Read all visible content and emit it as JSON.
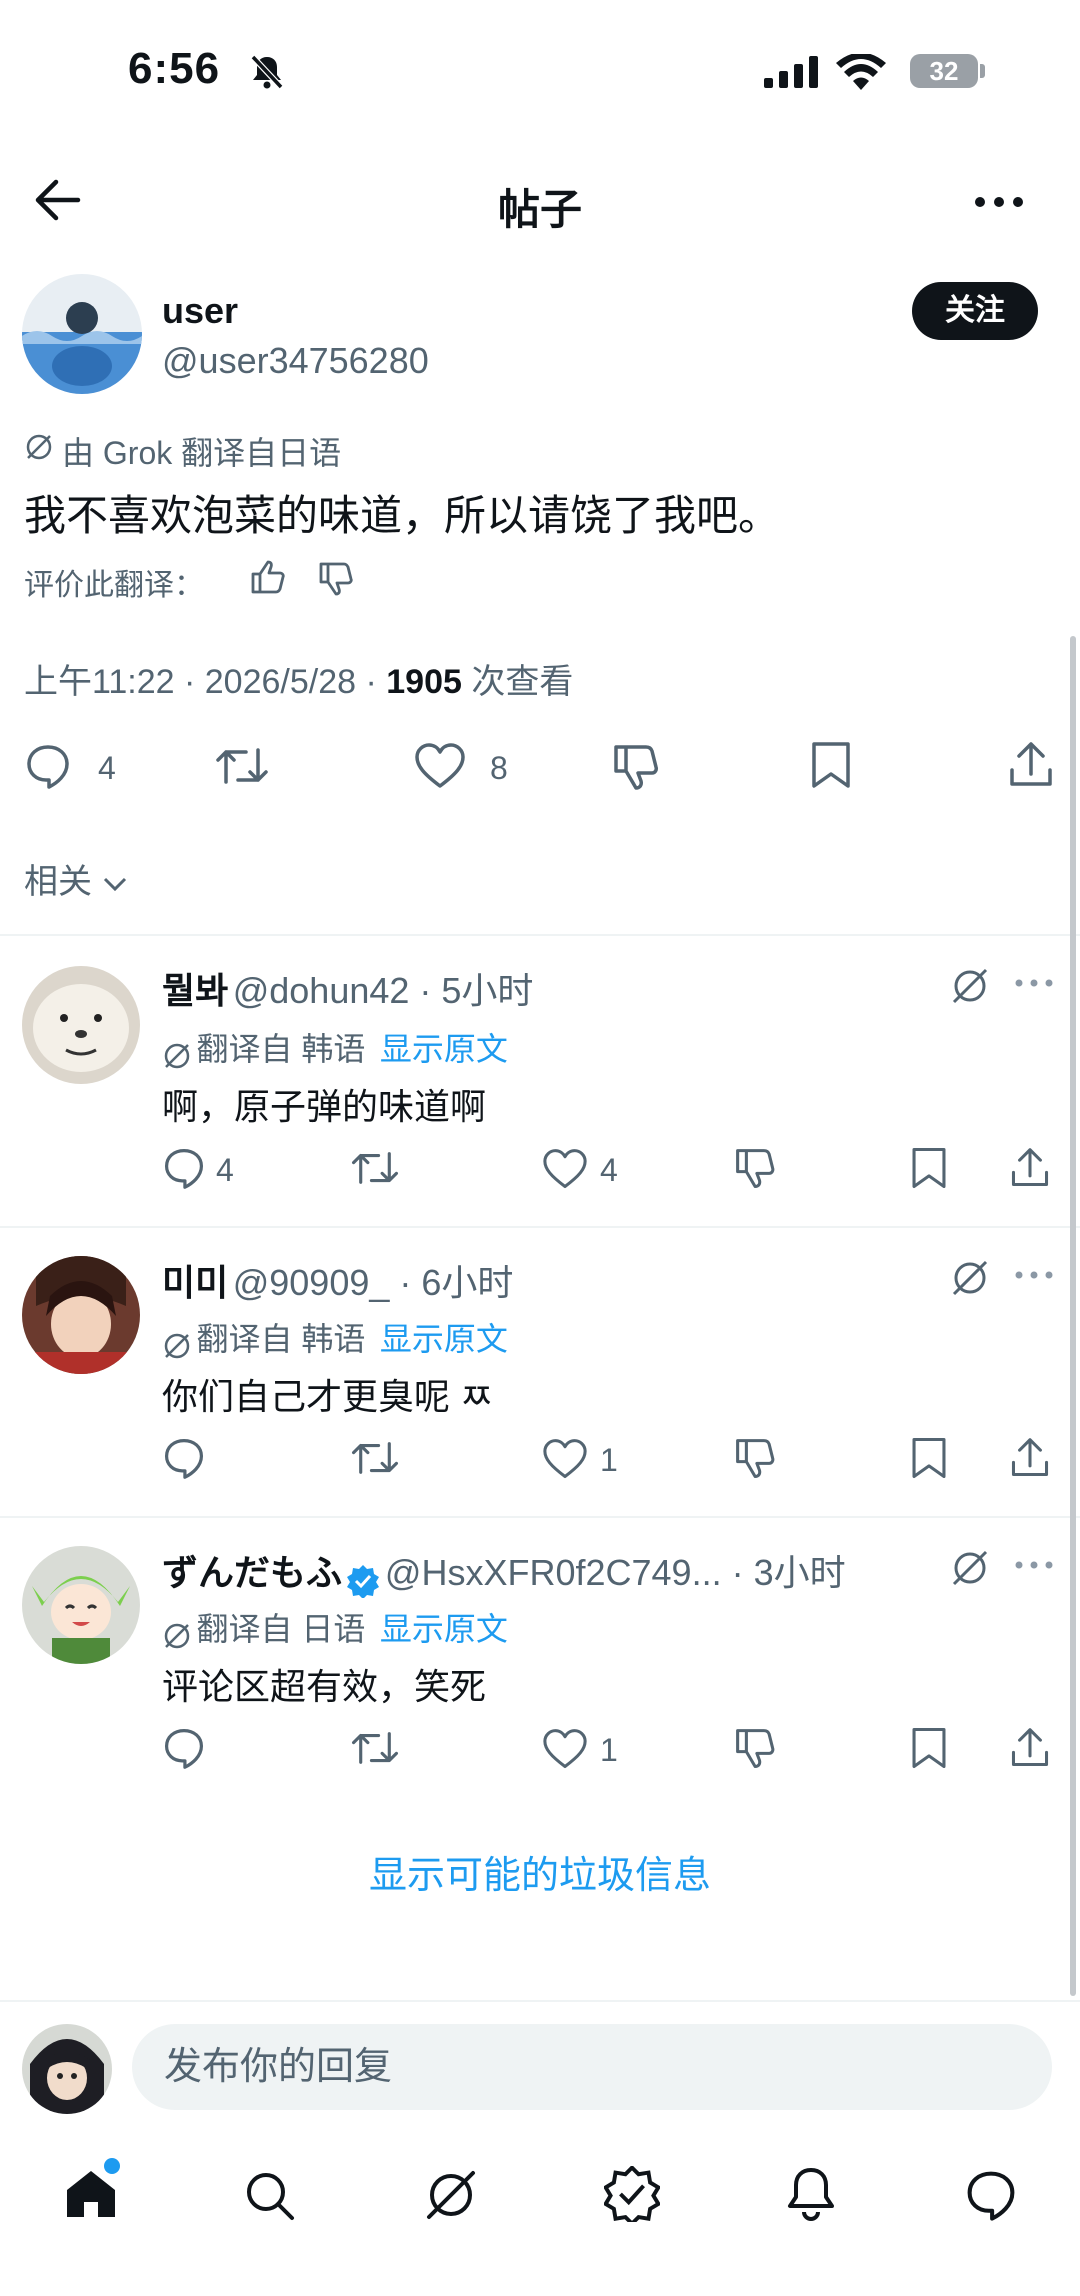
{
  "status_bar": {
    "time": "6:56",
    "battery": "32"
  },
  "header": {
    "title": "帖子"
  },
  "post": {
    "name": "user",
    "handle": "@user34756280",
    "follow_label": "关注",
    "translated_note": "由 Grok 翻译自日语",
    "text": "我不喜欢泡菜的味道，所以请饶了我吧。",
    "rate_translation": "评价此翻译：",
    "time": "上午11:22 · 2026/5/28 · ",
    "views": "1905",
    "views_label": " 次查看",
    "replies": "4",
    "likes": "8"
  },
  "related_label": "相关",
  "replies": [
    {
      "name": "뭘봐",
      "handle": "@dohun42 · 5小时",
      "translated_note": "翻译自 韩语",
      "show_original": "显示原文",
      "text": "啊，原子弹的味道啊",
      "reply_count": "4",
      "like_count": "4"
    },
    {
      "name": "미미",
      "handle": "@90909_ · 6小时",
      "translated_note": "翻译自 韩语",
      "show_original": "显示原文",
      "text": "你们自己才更臭呢 ㅉ",
      "reply_count": "",
      "like_count": "1"
    },
    {
      "name": "ずんだもふ",
      "handle": "@HsxXFR0f2C749... · 3小时",
      "translated_note": "翻译自 日语",
      "show_original": "显示原文",
      "text": "评论区超有效，笑死",
      "reply_count": "",
      "like_count": "1"
    }
  ],
  "show_spam": "显示可能的垃圾信息",
  "compose": {
    "placeholder": "发布你的回复"
  },
  "colors": {
    "accent": "#1d9bf0",
    "text": "#0f1419",
    "secondary": "#536471"
  }
}
